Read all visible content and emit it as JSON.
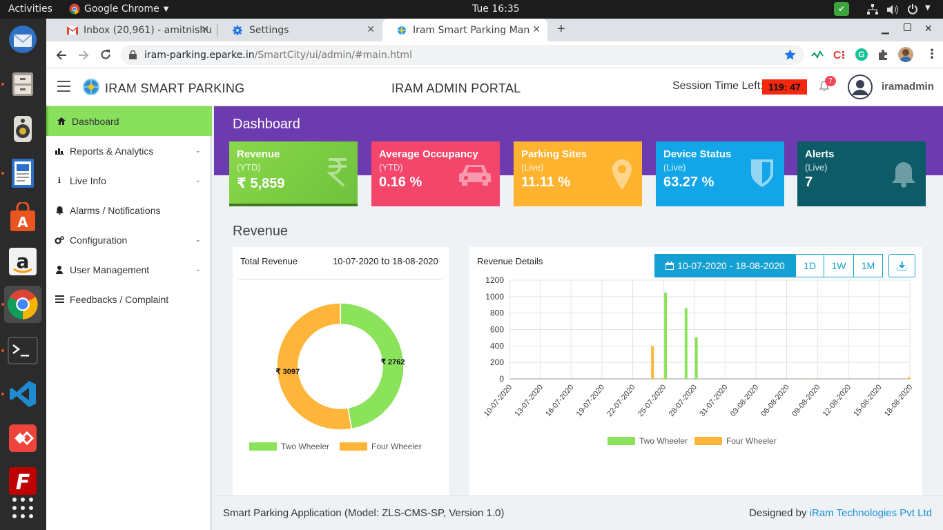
{
  "system": {
    "activities": "Activities",
    "app_name": "Google Chrome",
    "clock": "Tue 16:35"
  },
  "browser": {
    "tabs": [
      {
        "label": "Inbox (20,961) - amitnishu"
      },
      {
        "label": "Settings"
      },
      {
        "label": "Iram Smart Parking Mana"
      }
    ],
    "url_domain": "iram-parking.eparke.in",
    "url_path": "/SmartCity/ui/admin/#main.html"
  },
  "header": {
    "brand": "IRAM SMART PARKING",
    "portal_title": "IRAM ADMIN PORTAL",
    "session_label": "Session Time Left:",
    "session_time": "119: 47",
    "notif_count": "7",
    "username": "iramadmin"
  },
  "sidebar": {
    "items": [
      {
        "label": "Dashboard"
      },
      {
        "label": "Reports & Analytics"
      },
      {
        "label": "Live Info"
      },
      {
        "label": "Alarms / Notifications"
      },
      {
        "label": "Configuration"
      },
      {
        "label": "User Management"
      },
      {
        "label": "Feedbacks / Complaint"
      }
    ]
  },
  "main": {
    "page_title": "Dashboard",
    "section_title": "Revenue"
  },
  "cards": [
    {
      "title": "Revenue",
      "sub": "(YTD)",
      "value": "₹ 5,859",
      "color": "#8bd14f",
      "icon": "rupee-icon"
    },
    {
      "title": "Average Occupancy",
      "sub": "(YTD)",
      "value": "0.16 %",
      "color": "#f4466b",
      "icon": "car-icon"
    },
    {
      "title": "Parking Sites",
      "sub": "(Live)",
      "value": "11.11 %",
      "color": "#ffb32f",
      "icon": "location-pin-icon"
    },
    {
      "title": "Device Status",
      "sub": "(Live)",
      "value": "63.27 %",
      "color": "#12a6e8",
      "icon": "shield-icon"
    },
    {
      "title": "Alerts",
      "sub": "(Live)",
      "value": "7",
      "color": "#0c5b67",
      "icon": "bell-icon"
    }
  ],
  "total_revenue": {
    "title": "Total Revenue",
    "from": "10-07-2020",
    "to_word": "to",
    "to": "18-08-2020"
  },
  "revenue_details": {
    "title": "Revenue Details",
    "date_range": "10-07-2020 - 18-08-2020",
    "range_buttons": [
      "1D",
      "1W",
      "1M"
    ]
  },
  "footer": {
    "left": "Smart Parking Application (Model: ZLS-CMS-SP, Version 1.0)",
    "designed_by": "Designed by",
    "company": "iRam Technologies Pvt Ltd"
  },
  "chart_data": [
    {
      "type": "pie",
      "title": "Total Revenue",
      "categories": [
        "Two Wheeler",
        "Four Wheeler"
      ],
      "values": [
        2762,
        3097
      ],
      "labels": [
        "₹ 2762",
        "₹ 3097"
      ],
      "colors": [
        "#8be35c",
        "#ffb53a"
      ],
      "legend": "bottom"
    },
    {
      "type": "bar",
      "title": "Revenue Details",
      "x_tick_labels": [
        "10-07-2020",
        "13-07-2020",
        "16-07-2020",
        "19-07-2020",
        "22-07-2020",
        "25-07-2020",
        "28-07-2020",
        "31-07-2020",
        "03-08-2020",
        "06-08-2020",
        "09-08-2020",
        "12-08-2020",
        "15-08-2020",
        "18-08-2020"
      ],
      "ylim": [
        0,
        1200
      ],
      "y_ticks": [
        0,
        200,
        400,
        600,
        800,
        1000,
        1200
      ],
      "grid": true,
      "legend": "bottom",
      "series": [
        {
          "name": "Two Wheeler",
          "color": "#8be35c",
          "points": [
            [
              "25-07-2020",
              1050
            ],
            [
              "27-07-2020",
              860
            ],
            [
              "28-07-2020",
              505
            ],
            [
              "08-08-2020",
              5
            ]
          ]
        },
        {
          "name": "Four Wheeler",
          "color": "#ffb53a",
          "points": [
            [
              "24-07-2020",
              400
            ],
            [
              "25-07-2020",
              10
            ],
            [
              "18-08-2020",
              20
            ]
          ]
        }
      ]
    }
  ]
}
